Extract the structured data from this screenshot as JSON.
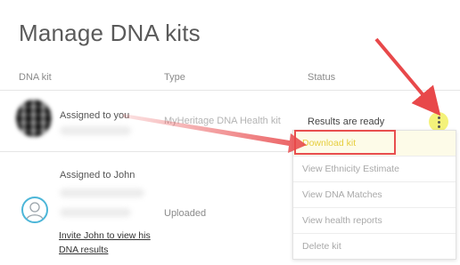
{
  "page": {
    "title": "Manage DNA kits"
  },
  "columns": {
    "kit": "DNA kit",
    "type": "Type",
    "status": "Status"
  },
  "rows": [
    {
      "assigned": "Assigned to you",
      "type": "MyHeritage DNA Health kit",
      "status": "Results are ready"
    },
    {
      "assigned": "Assigned to John",
      "type": "Uploaded",
      "invite_link": "Invite John to view his DNA results"
    }
  ],
  "menu": {
    "items": [
      "Download kit",
      "View Ethnicity Estimate",
      "View DNA Matches",
      "View health reports",
      "Delete kit"
    ]
  },
  "colors": {
    "annotation_arrow": "#e8484a",
    "kebab_highlight": "#f4f27a",
    "user_icon_ring": "#4cb6d8"
  },
  "icons": {
    "kebab": "more-vertical-icon",
    "user": "user-avatar-icon"
  }
}
